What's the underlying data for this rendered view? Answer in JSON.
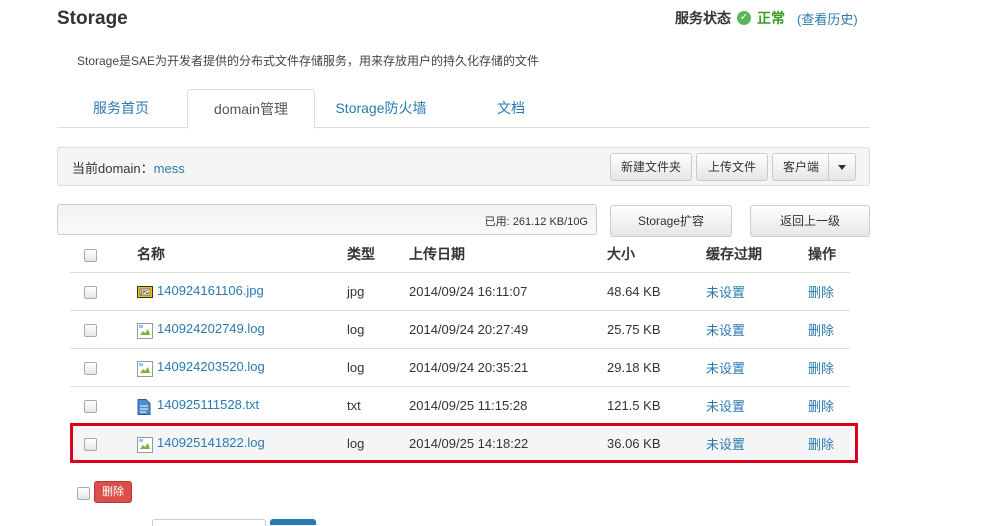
{
  "header": {
    "title": "Storage",
    "status_label": "服务状态",
    "status_value": "正常",
    "history_link": "(查看历史)",
    "description": "Storage是SAE为开发者提供的分布式文件存储服务，用来存放用户的持久化存储的文件"
  },
  "tabs": [
    "服务首页",
    "domain管理",
    "Storage防火墙",
    "文档"
  ],
  "toolbar": {
    "current_label": "当前domain：",
    "domain": "mess",
    "new_folder": "新建文件夹",
    "upload": "上传文件",
    "client": "客户端"
  },
  "usage": {
    "text": "已用: 261.12 KB/10G",
    "expand_button": "Storage扩容",
    "back_button": "返回上一级"
  },
  "table": {
    "headers": [
      "名称",
      "类型",
      "上传日期",
      "大小",
      "缓存过期",
      "操作"
    ],
    "rows": [
      {
        "name": "140924161106.jpg",
        "type": "jpg",
        "date": "2014/09/24 16:11:07",
        "size": "48.64 KB",
        "cache": "未设置",
        "action": "删除",
        "icon": "jpg-file-icon"
      },
      {
        "name": "140924202749.log",
        "type": "log",
        "date": "2014/09/24 20:27:49",
        "size": "25.75 KB",
        "cache": "未设置",
        "action": "删除",
        "icon": "broken-image-icon"
      },
      {
        "name": "140924203520.log",
        "type": "log",
        "date": "2014/09/24 20:35:21",
        "size": "29.18 KB",
        "cache": "未设置",
        "action": "删除",
        "icon": "broken-image-icon"
      },
      {
        "name": "140925111528.txt",
        "type": "txt",
        "date": "2014/09/25 11:15:28",
        "size": "121.5 KB",
        "cache": "未设置",
        "action": "删除",
        "icon": "txt-file-icon"
      },
      {
        "name": "140925141822.log",
        "type": "log",
        "date": "2014/09/25 14:18:22",
        "size": "36.06 KB",
        "cache": "未设置",
        "action": "删除",
        "icon": "broken-image-icon"
      }
    ]
  },
  "bulk_delete": "删除",
  "colors": {
    "link": "#2a7ab0",
    "ok": "#3a9d23",
    "danger": "#da4f49",
    "highlight": "#d9001b"
  }
}
